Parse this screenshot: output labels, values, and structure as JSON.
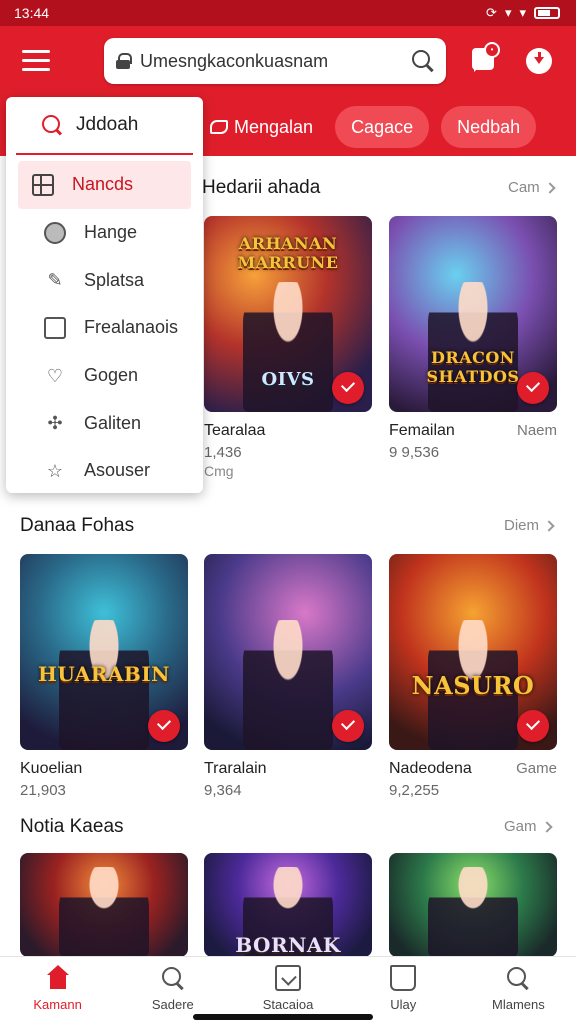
{
  "status": {
    "time": "13:44"
  },
  "header": {
    "search_text": "Umesngkaconkuasnam",
    "badge": "•"
  },
  "chips": {
    "plain": "Mengalan",
    "chip1": "Cagace",
    "chip2": "Nedbah"
  },
  "dropdown": {
    "search_label": "Jddoah",
    "items": [
      {
        "label": "Nancds",
        "icon": "grid-icon"
      },
      {
        "label": "Hange",
        "icon": "circle-icon"
      },
      {
        "label": "Splatsa",
        "icon": "pin-icon"
      },
      {
        "label": "Frealanaois",
        "icon": "image-icon"
      },
      {
        "label": "Gogen",
        "icon": "heart-icon"
      },
      {
        "label": "Galiten",
        "icon": "puzzle-icon"
      },
      {
        "label": "Asouser",
        "icon": "star-icon"
      }
    ]
  },
  "section1": {
    "title": "Hedarii ahada",
    "more": "Cam",
    "cards": [
      {
        "name": "Tearalaa",
        "meta": "1,436",
        "meta2": "Cmg",
        "art_title": "ARHANAN\nMARRUNE",
        "art_sub": "OIVS"
      },
      {
        "name": "Femailan",
        "meta": "9 9,536",
        "aside": "Naem",
        "art_title": "DRACON\nSHATDOS"
      }
    ]
  },
  "section2": {
    "title": "Danaa Fohas",
    "more": "Diem",
    "cards": [
      {
        "name": "Kuoelian",
        "meta": "21,903",
        "art_title": "HUARABIN"
      },
      {
        "name": "Traralain",
        "meta": "9,364"
      },
      {
        "name": "Nadeodena",
        "meta": "9,2,255",
        "aside": "Game",
        "art_title": "NASURO"
      }
    ]
  },
  "section3": {
    "title": "Notia Kaeas",
    "more": "Gam",
    "cards": [
      {
        "name": ""
      },
      {
        "name": "",
        "art_title": "BORNAK"
      },
      {
        "name": ""
      }
    ]
  },
  "bottom_nav": [
    {
      "label": "Kamann",
      "icon": "home-icon",
      "active": true
    },
    {
      "label": "Sadere",
      "icon": "search-icon"
    },
    {
      "label": "Stacaioa",
      "icon": "edit-box-icon"
    },
    {
      "label": "Ulay",
      "icon": "bag-icon"
    },
    {
      "label": "Mlamens",
      "icon": "search-icon"
    }
  ],
  "colors": {
    "brand_red": "#e01e2b",
    "status_red": "#b3101d",
    "active_item_bg": "#fde7e8"
  }
}
